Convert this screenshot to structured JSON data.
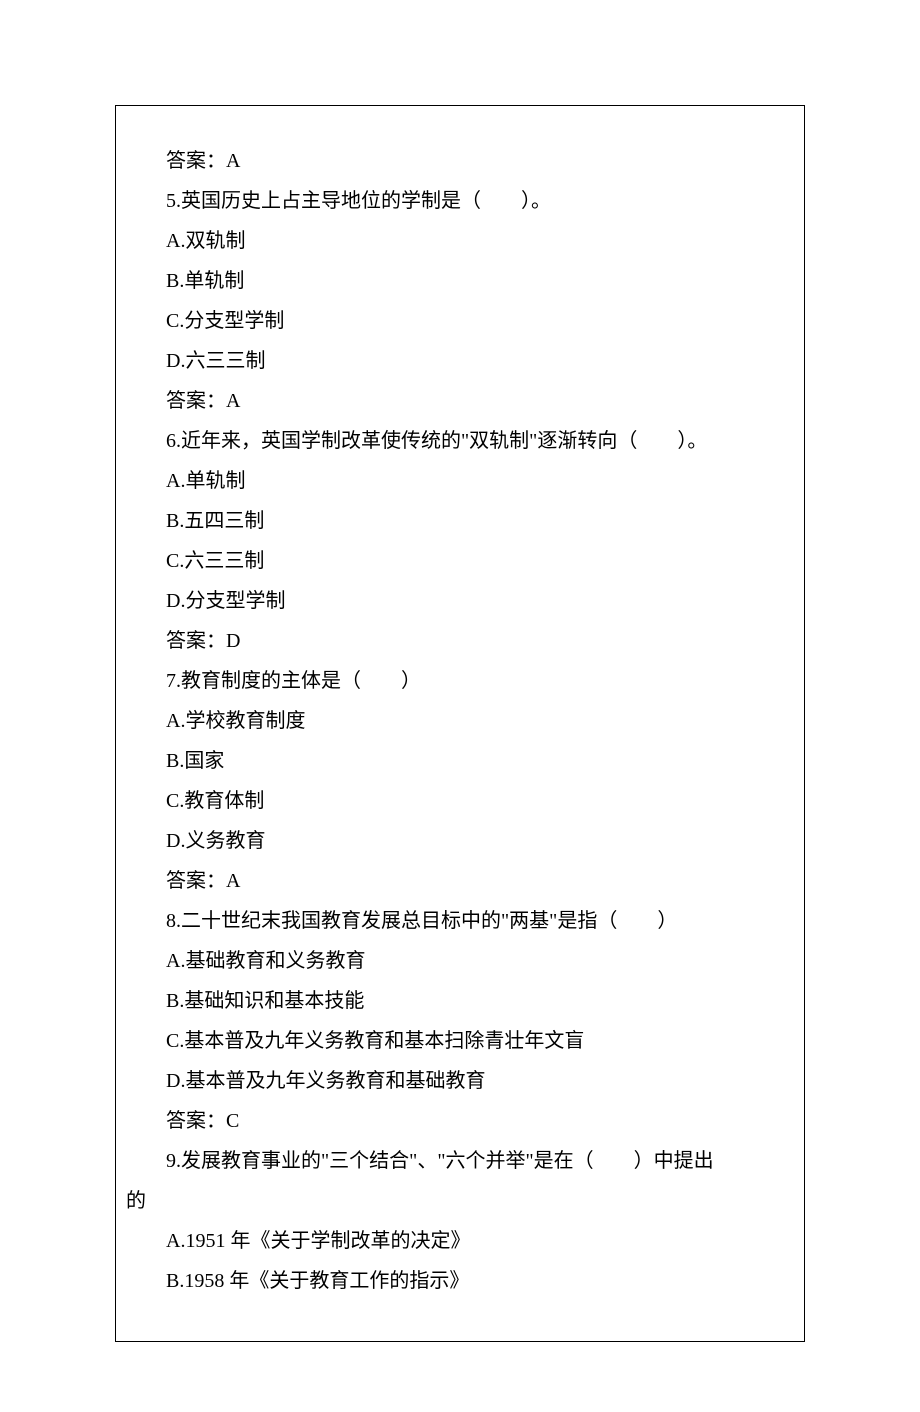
{
  "lines": [
    {
      "text": "答案：A",
      "indent": true
    },
    {
      "text": "5.英国历史上占主导地位的学制是（　　）。",
      "indent": true
    },
    {
      "text": "A.双轨制",
      "indent": true
    },
    {
      "text": "B.单轨制",
      "indent": true
    },
    {
      "text": "C.分支型学制",
      "indent": true
    },
    {
      "text": "D.六三三制",
      "indent": true
    },
    {
      "text": "答案：A",
      "indent": true
    },
    {
      "text": "6.近年来，英国学制改革使传统的\"双轨制\"逐渐转向（　　）。",
      "indent": true
    },
    {
      "text": "A.单轨制",
      "indent": true
    },
    {
      "text": "B.五四三制",
      "indent": true
    },
    {
      "text": "C.六三三制",
      "indent": true
    },
    {
      "text": "D.分支型学制",
      "indent": true
    },
    {
      "text": "答案：D",
      "indent": true
    },
    {
      "text": "7.教育制度的主体是（　　）",
      "indent": true
    },
    {
      "text": "A.学校教育制度",
      "indent": true
    },
    {
      "text": "B.国家",
      "indent": true
    },
    {
      "text": "C.教育体制",
      "indent": true
    },
    {
      "text": "D.义务教育",
      "indent": true
    },
    {
      "text": "答案：A",
      "indent": true
    },
    {
      "text": "8.二十世纪末我国教育发展总目标中的\"两基\"是指（　　）",
      "indent": true
    },
    {
      "text": "A.基础教育和义务教育",
      "indent": true
    },
    {
      "text": "B.基础知识和基本技能",
      "indent": true
    },
    {
      "text": "C.基本普及九年义务教育和基本扫除青壮年文盲",
      "indent": true
    },
    {
      "text": "D.基本普及九年义务教育和基础教育",
      "indent": true
    },
    {
      "text": "答案：C",
      "indent": true
    },
    {
      "text": "9.发展教育事业的\"三个结合\"、\"六个并举\"是在（　　）中提出",
      "indent": true
    },
    {
      "text": "的",
      "indent": false
    },
    {
      "text": "A.1951 年《关于学制改革的决定》",
      "indent": true
    },
    {
      "text": "B.1958 年《关于教育工作的指示》",
      "indent": true
    }
  ]
}
